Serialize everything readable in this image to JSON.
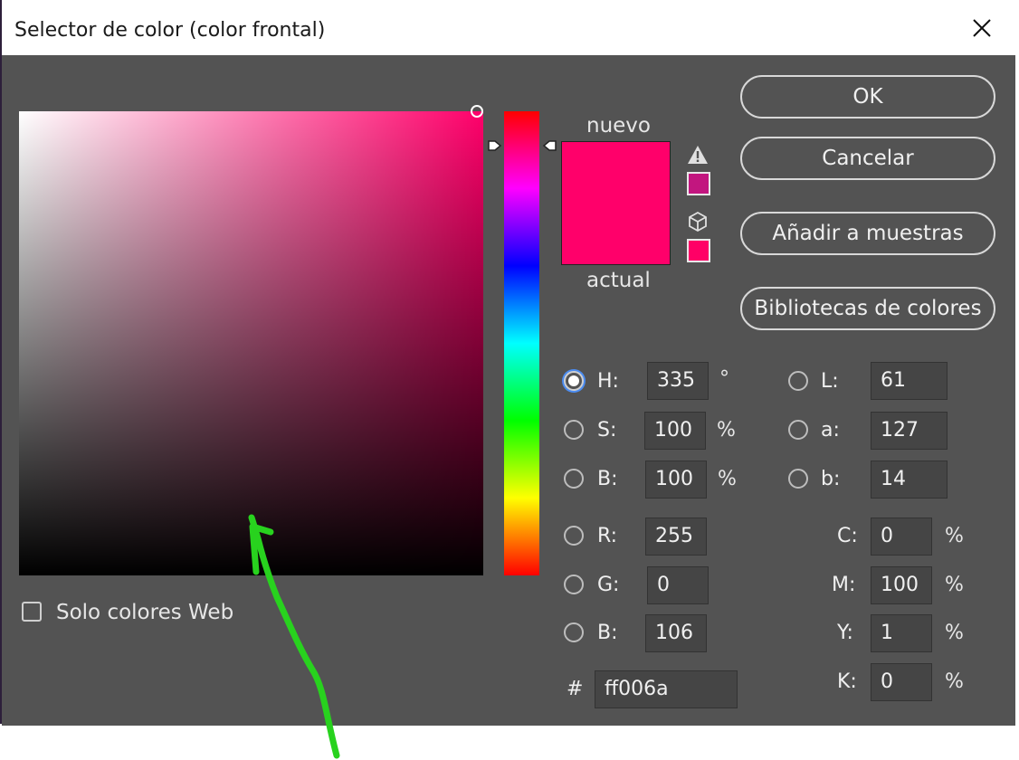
{
  "window": {
    "title": "Selector de color (color frontal)"
  },
  "swatches": {
    "new_label": "nuevo",
    "current_label": "actual",
    "new_color": "#ff006a",
    "current_color": "#ff006a",
    "gamut_color": "#c2167f",
    "web_color": "#ff0066"
  },
  "buttons": {
    "ok": "OK",
    "cancel": "Cancelar",
    "add_swatches": "Añadir a muestras",
    "libraries": "Bibliotecas de colores"
  },
  "web_only": {
    "label": "Solo colores Web",
    "checked": false
  },
  "fields": {
    "H": {
      "label": "H:",
      "value": "335",
      "unit": "°"
    },
    "S": {
      "label": "S:",
      "value": "100",
      "unit": "%"
    },
    "Bv": {
      "label": "B:",
      "value": "100",
      "unit": "%"
    },
    "R": {
      "label": "R:",
      "value": "255"
    },
    "G": {
      "label": "G:",
      "value": "0"
    },
    "Bb": {
      "label": "B:",
      "value": "106"
    },
    "L": {
      "label": "L:",
      "value": "61"
    },
    "a": {
      "label": "a:",
      "value": "127"
    },
    "b": {
      "label": "b:",
      "value": "14"
    },
    "C": {
      "label": "C:",
      "value": "0",
      "unit": "%"
    },
    "M": {
      "label": "M:",
      "value": "100",
      "unit": "%"
    },
    "Y": {
      "label": "Y:",
      "value": "1",
      "unit": "%"
    },
    "K": {
      "label": "K:",
      "value": "0",
      "unit": "%"
    },
    "hex": {
      "label": "#",
      "value": "ff006a"
    }
  },
  "colors": {
    "dialog_bg": "#535353",
    "input_bg": "#454545",
    "annotation": "#28d21e"
  },
  "icons": [
    "close-icon",
    "warning-icon",
    "cube-icon",
    "hue-slider-arrow-icon",
    "annotation-arrow"
  ]
}
